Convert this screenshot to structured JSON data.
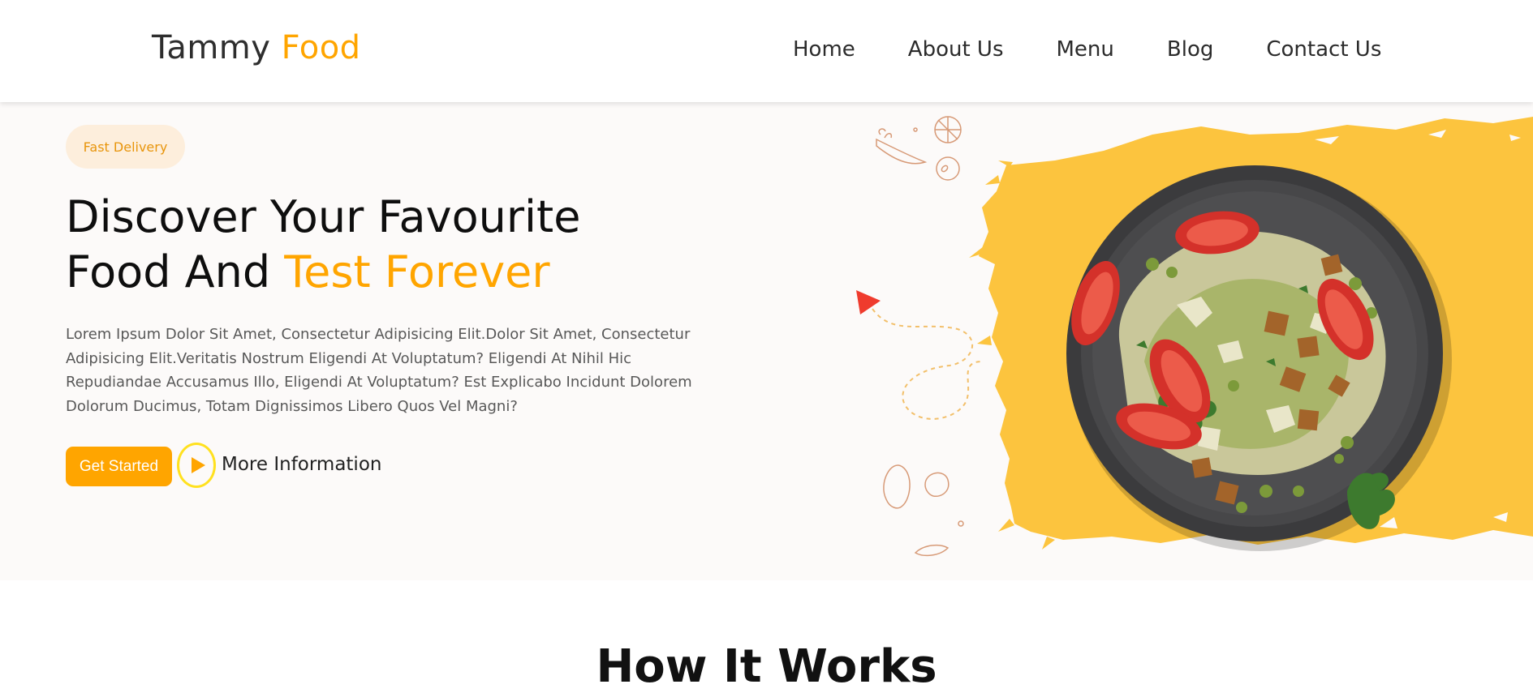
{
  "header": {
    "logo_main": "Tammy",
    "logo_accent": "Food",
    "nav": [
      "Home",
      "About Us",
      "Menu",
      "Blog",
      "Contact Us"
    ]
  },
  "hero": {
    "badge": "Fast Delivery",
    "title_line1": "Discover Your Favourite",
    "title_line2_main": "Food And",
    "title_line2_accent": "Test Forever",
    "description": "Lorem Ipsum Dolor Sit Amet, Consectetur Adipisicing Elit.Dolor Sit Amet, Consectetur Adipisicing Elit.Veritatis Nostrum Eligendi At Voluptatum? Eligendi At Nihil Hic Repudiandae Accusamus Illo, Eligendi At Voluptatum? Est Explicabo Incidunt Dolorem Dolorum Ducimus, Totam Dignissimos Libero Quos Vel Magni?",
    "get_started": "Get Started",
    "more_info": "More Information",
    "image_icon": "salad-plate-image"
  },
  "section2": {
    "title": "How It Works"
  },
  "colors": {
    "accent": "#ffa500",
    "hero_bg": "#fcfaf9",
    "brush": "#fcc43e",
    "badge_bg": "#fdeedc",
    "play_ring": "#ffe11f",
    "arrow_red": "#ef3b2d"
  }
}
